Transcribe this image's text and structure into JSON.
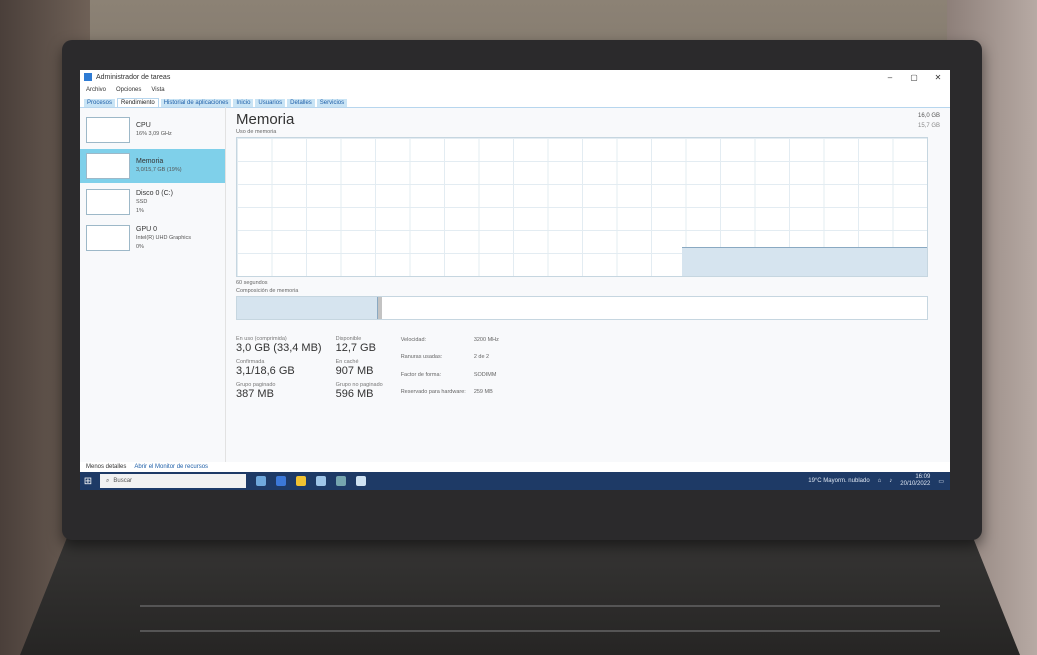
{
  "window": {
    "title": "Administrador de tareas",
    "controls": [
      "–",
      "▢",
      "✕"
    ]
  },
  "menu": [
    "Archivo",
    "Opciones",
    "Vista"
  ],
  "tabs": [
    {
      "label": "Procesos"
    },
    {
      "label": "Rendimiento"
    },
    {
      "label": "Historial de aplicaciones"
    },
    {
      "label": "Inicio"
    },
    {
      "label": "Usuarios"
    },
    {
      "label": "Detalles"
    },
    {
      "label": "Servicios"
    }
  ],
  "sidebar": {
    "items": [
      {
        "name": "CPU",
        "sub": "16% 3,09 GHz"
      },
      {
        "name": "Memoria",
        "sub": "3,0/15,7 GB (19%)"
      },
      {
        "name": "Disco 0 (C:)",
        "sub": "SSD",
        "sub2": "1%"
      },
      {
        "name": "GPU 0",
        "sub": "Intel(R) UHD Graphics",
        "sub2": "0%"
      }
    ]
  },
  "main": {
    "title": "Memoria",
    "total": "16,0 GB",
    "graph_label": "Uso de memoria",
    "graph_max": "15,7 GB",
    "graph_time": "60 segundos",
    "composition_label": "Composición de memoria",
    "usage_fraction": 0.19
  },
  "stats": {
    "in_use_label": "En uso (comprimida)",
    "in_use": "3,0 GB (33,4 MB)",
    "available_label": "Disponible",
    "available": "12,7 GB",
    "committed_label": "Confirmada",
    "committed": "3,1/18,6 GB",
    "cached_label": "En caché",
    "cached": "907 MB",
    "paged_label": "Grupo paginado",
    "paged": "387 MB",
    "nonpaged_label": "Grupo no paginado",
    "nonpaged": "596 MB",
    "kv": [
      {
        "k": "Velocidad:",
        "v": "3200 MHz"
      },
      {
        "k": "Ranuras usadas:",
        "v": "2 de 2"
      },
      {
        "k": "Factor de forma:",
        "v": "SODIMM"
      },
      {
        "k": "Reservado para hardware:",
        "v": "259 MB"
      }
    ]
  },
  "footer": {
    "fewer_details": "Menos detalles",
    "open_monitor": "Abrir el Monitor de recursos"
  },
  "taskbar": {
    "search_placeholder": "Buscar",
    "weather": "19°C Mayorm. nublado",
    "time": "16:09",
    "date": "20/10/2022"
  }
}
